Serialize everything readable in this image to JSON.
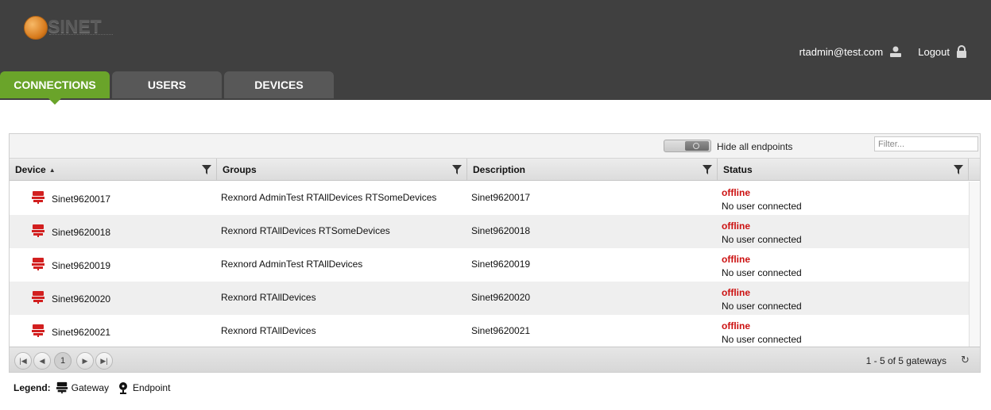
{
  "brand": {
    "name": "SINET",
    "icon": "sinet-logo"
  },
  "user": {
    "email": "rtadmin@test.com",
    "logout_label": "Logout"
  },
  "tabs": [
    {
      "label": "CONNECTIONS",
      "active": true
    },
    {
      "label": "USERS",
      "active": false
    },
    {
      "label": "DEVICES",
      "active": false
    }
  ],
  "toolbar": {
    "toggle_label": "Hide all endpoints",
    "filter_placeholder": "Filter..."
  },
  "columns": {
    "device": "Device",
    "groups": "Groups",
    "description": "Description",
    "status": "Status"
  },
  "rows": [
    {
      "device": "Sinet9620017",
      "groups": "Rexnord AdminTest RTAllDevices RTSomeDevices",
      "description": "Sinet9620017",
      "status": "offline",
      "status_detail": "No user connected"
    },
    {
      "device": "Sinet9620018",
      "groups": "Rexnord RTAllDevices RTSomeDevices",
      "description": "Sinet9620018",
      "status": "offline",
      "status_detail": "No user connected"
    },
    {
      "device": "Sinet9620019",
      "groups": "Rexnord AdminTest RTAllDevices",
      "description": "Sinet9620019",
      "status": "offline",
      "status_detail": "No user connected"
    },
    {
      "device": "Sinet9620020",
      "groups": "Rexnord RTAllDevices",
      "description": "Sinet9620020",
      "status": "offline",
      "status_detail": "No user connected"
    },
    {
      "device": "Sinet9620021",
      "groups": "Rexnord RTAllDevices",
      "description": "Sinet9620021",
      "status": "offline",
      "status_detail": "No user connected"
    }
  ],
  "pager": {
    "page": "1",
    "info": "1 - 5 of 5 gateways"
  },
  "legend": {
    "title": "Legend:",
    "gateway": "Gateway",
    "endpoint": "Endpoint"
  },
  "colors": {
    "header_bg": "#404040",
    "tab_active": "#6aa42a",
    "tab_inactive": "#585858",
    "offline": "#cc1111",
    "gateway_icon": "#d21f1f"
  }
}
